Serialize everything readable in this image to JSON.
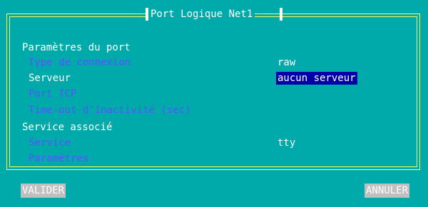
{
  "dialog": {
    "title": "Port Logique Net1"
  },
  "params": {
    "section_port": "Paramètres du port",
    "connection_type": {
      "label": "Type de connexion",
      "value": "raw"
    },
    "server": {
      "label": "Serveur",
      "value": "aucun serveur"
    },
    "tcp_port": {
      "label": "Port TCP",
      "value": ""
    },
    "timeout": {
      "label": "Time-out d'inactivité (sec)",
      "value": ""
    },
    "section_service": "Service associé",
    "service": {
      "label": "Service",
      "value": "tty"
    },
    "service_params": {
      "label": "Paramètres",
      "value": ""
    }
  },
  "buttons": {
    "validate": "VALIDER",
    "cancel": "ANNULER"
  },
  "colors": {
    "background": "#00aaaa",
    "frame": "#ffff55",
    "text": "#ffffff",
    "inactive_label": "#5555ff",
    "highlight": "#0000aa",
    "button_bg": "#c0c0c0"
  }
}
